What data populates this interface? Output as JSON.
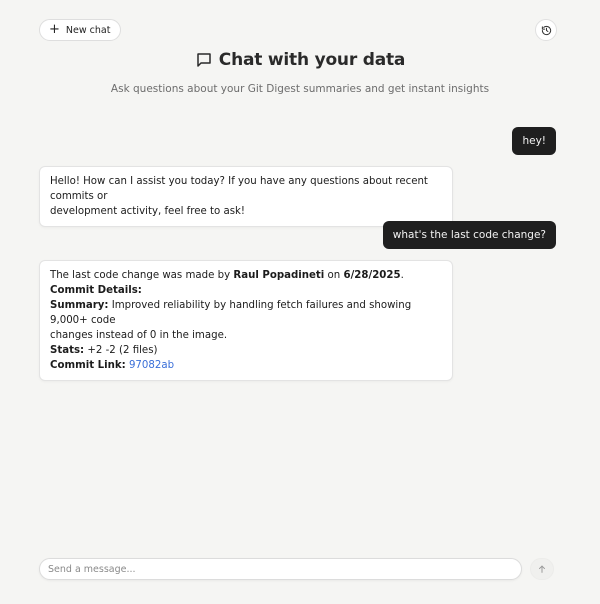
{
  "header": {
    "new_chat_label": "New chat",
    "title": "Chat with your data",
    "subtitle": "Ask questions about your Git Digest summaries and get instant insights"
  },
  "messages": [
    {
      "role": "user",
      "text": "hey!"
    },
    {
      "role": "assistant",
      "text_line1": "Hello! How can I assist you today? If you have any questions about recent commits or",
      "text_line2": "development activity, feel free to ask!"
    },
    {
      "role": "user",
      "text": "what's the last code change?"
    },
    {
      "role": "assistant",
      "intro_prefix": "The last code change was made by",
      "author": "Raul Popadineti",
      "on_word": "on",
      "date": "6/28/2025",
      "period": ".",
      "details_heading": "Commit Details:",
      "summary_label": "Summary:",
      "summary_line1": "Improved reliability by handling fetch failures and showing 9,000+ code",
      "summary_line2": "changes instead of 0 in the image.",
      "stats_label": "Stats:",
      "stats_value": "+2 -2 (2 files)",
      "link_label": "Commit Link:",
      "link_text": "97082ab"
    }
  ],
  "composer": {
    "placeholder": "Send a message..."
  },
  "icons": {
    "new_chat": "plus-icon",
    "history": "history-icon",
    "title": "chat-bubble-icon",
    "send": "arrow-up-icon"
  },
  "colors": {
    "background": "#f5f5f3",
    "user_bubble": "#1f1f1f",
    "link": "#3a6fd8"
  }
}
